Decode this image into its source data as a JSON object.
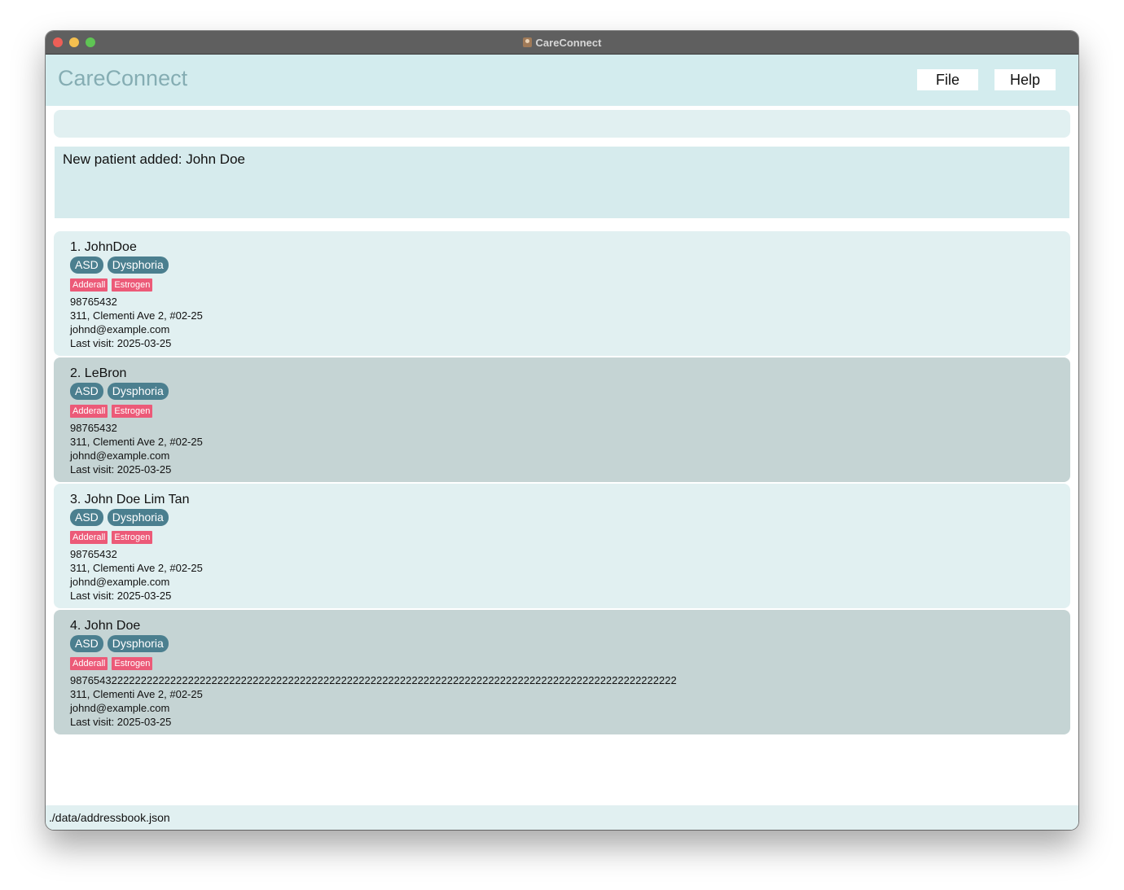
{
  "window": {
    "title": "CareConnect"
  },
  "header": {
    "brand": "CareConnect",
    "menu": [
      {
        "label": "File"
      },
      {
        "label": "Help"
      }
    ]
  },
  "command": {
    "value": ""
  },
  "result": {
    "text": "New patient added: John Doe"
  },
  "patients": [
    {
      "name": "1. JohnDoe",
      "conditions": [
        "ASD",
        "Dysphoria"
      ],
      "medications": [
        "Adderall",
        "Estrogen"
      ],
      "phone": "98765432",
      "address": "311, Clementi Ave 2, #02-25",
      "email": "johnd@example.com",
      "last_visit": "Last visit: 2025-03-25"
    },
    {
      "name": "2. LeBron",
      "conditions": [
        "ASD",
        "Dysphoria"
      ],
      "medications": [
        "Adderall",
        "Estrogen"
      ],
      "phone": "98765432",
      "address": "311, Clementi Ave 2, #02-25",
      "email": "johnd@example.com",
      "last_visit": "Last visit: 2025-03-25"
    },
    {
      "name": "3. John Doe Lim Tan",
      "conditions": [
        "ASD",
        "Dysphoria"
      ],
      "medications": [
        "Adderall",
        "Estrogen"
      ],
      "phone": "98765432",
      "address": "311, Clementi Ave 2, #02-25",
      "email": "johnd@example.com",
      "last_visit": "Last visit: 2025-03-25"
    },
    {
      "name": "4. John Doe",
      "conditions": [
        "ASD",
        "Dysphoria"
      ],
      "medications": [
        "Adderall",
        "Estrogen"
      ],
      "phone": "9876543222222222222222222222222222222222222222222222222222222222222222222222222222222222222222222222222",
      "address": "311, Clementi Ave 2, #02-25",
      "email": "johnd@example.com",
      "last_visit": "Last visit: 2025-03-25"
    }
  ],
  "status_bar": {
    "path": "./data/addressbook.json"
  },
  "colors": {
    "header_bg": "#d3ecee",
    "card_light": "#e1f0f1",
    "card_dark": "#c5d4d4",
    "condition_tag": "#4b7f8f",
    "medication_tag": "#ec5a78",
    "brand_text": "#85adb3"
  }
}
